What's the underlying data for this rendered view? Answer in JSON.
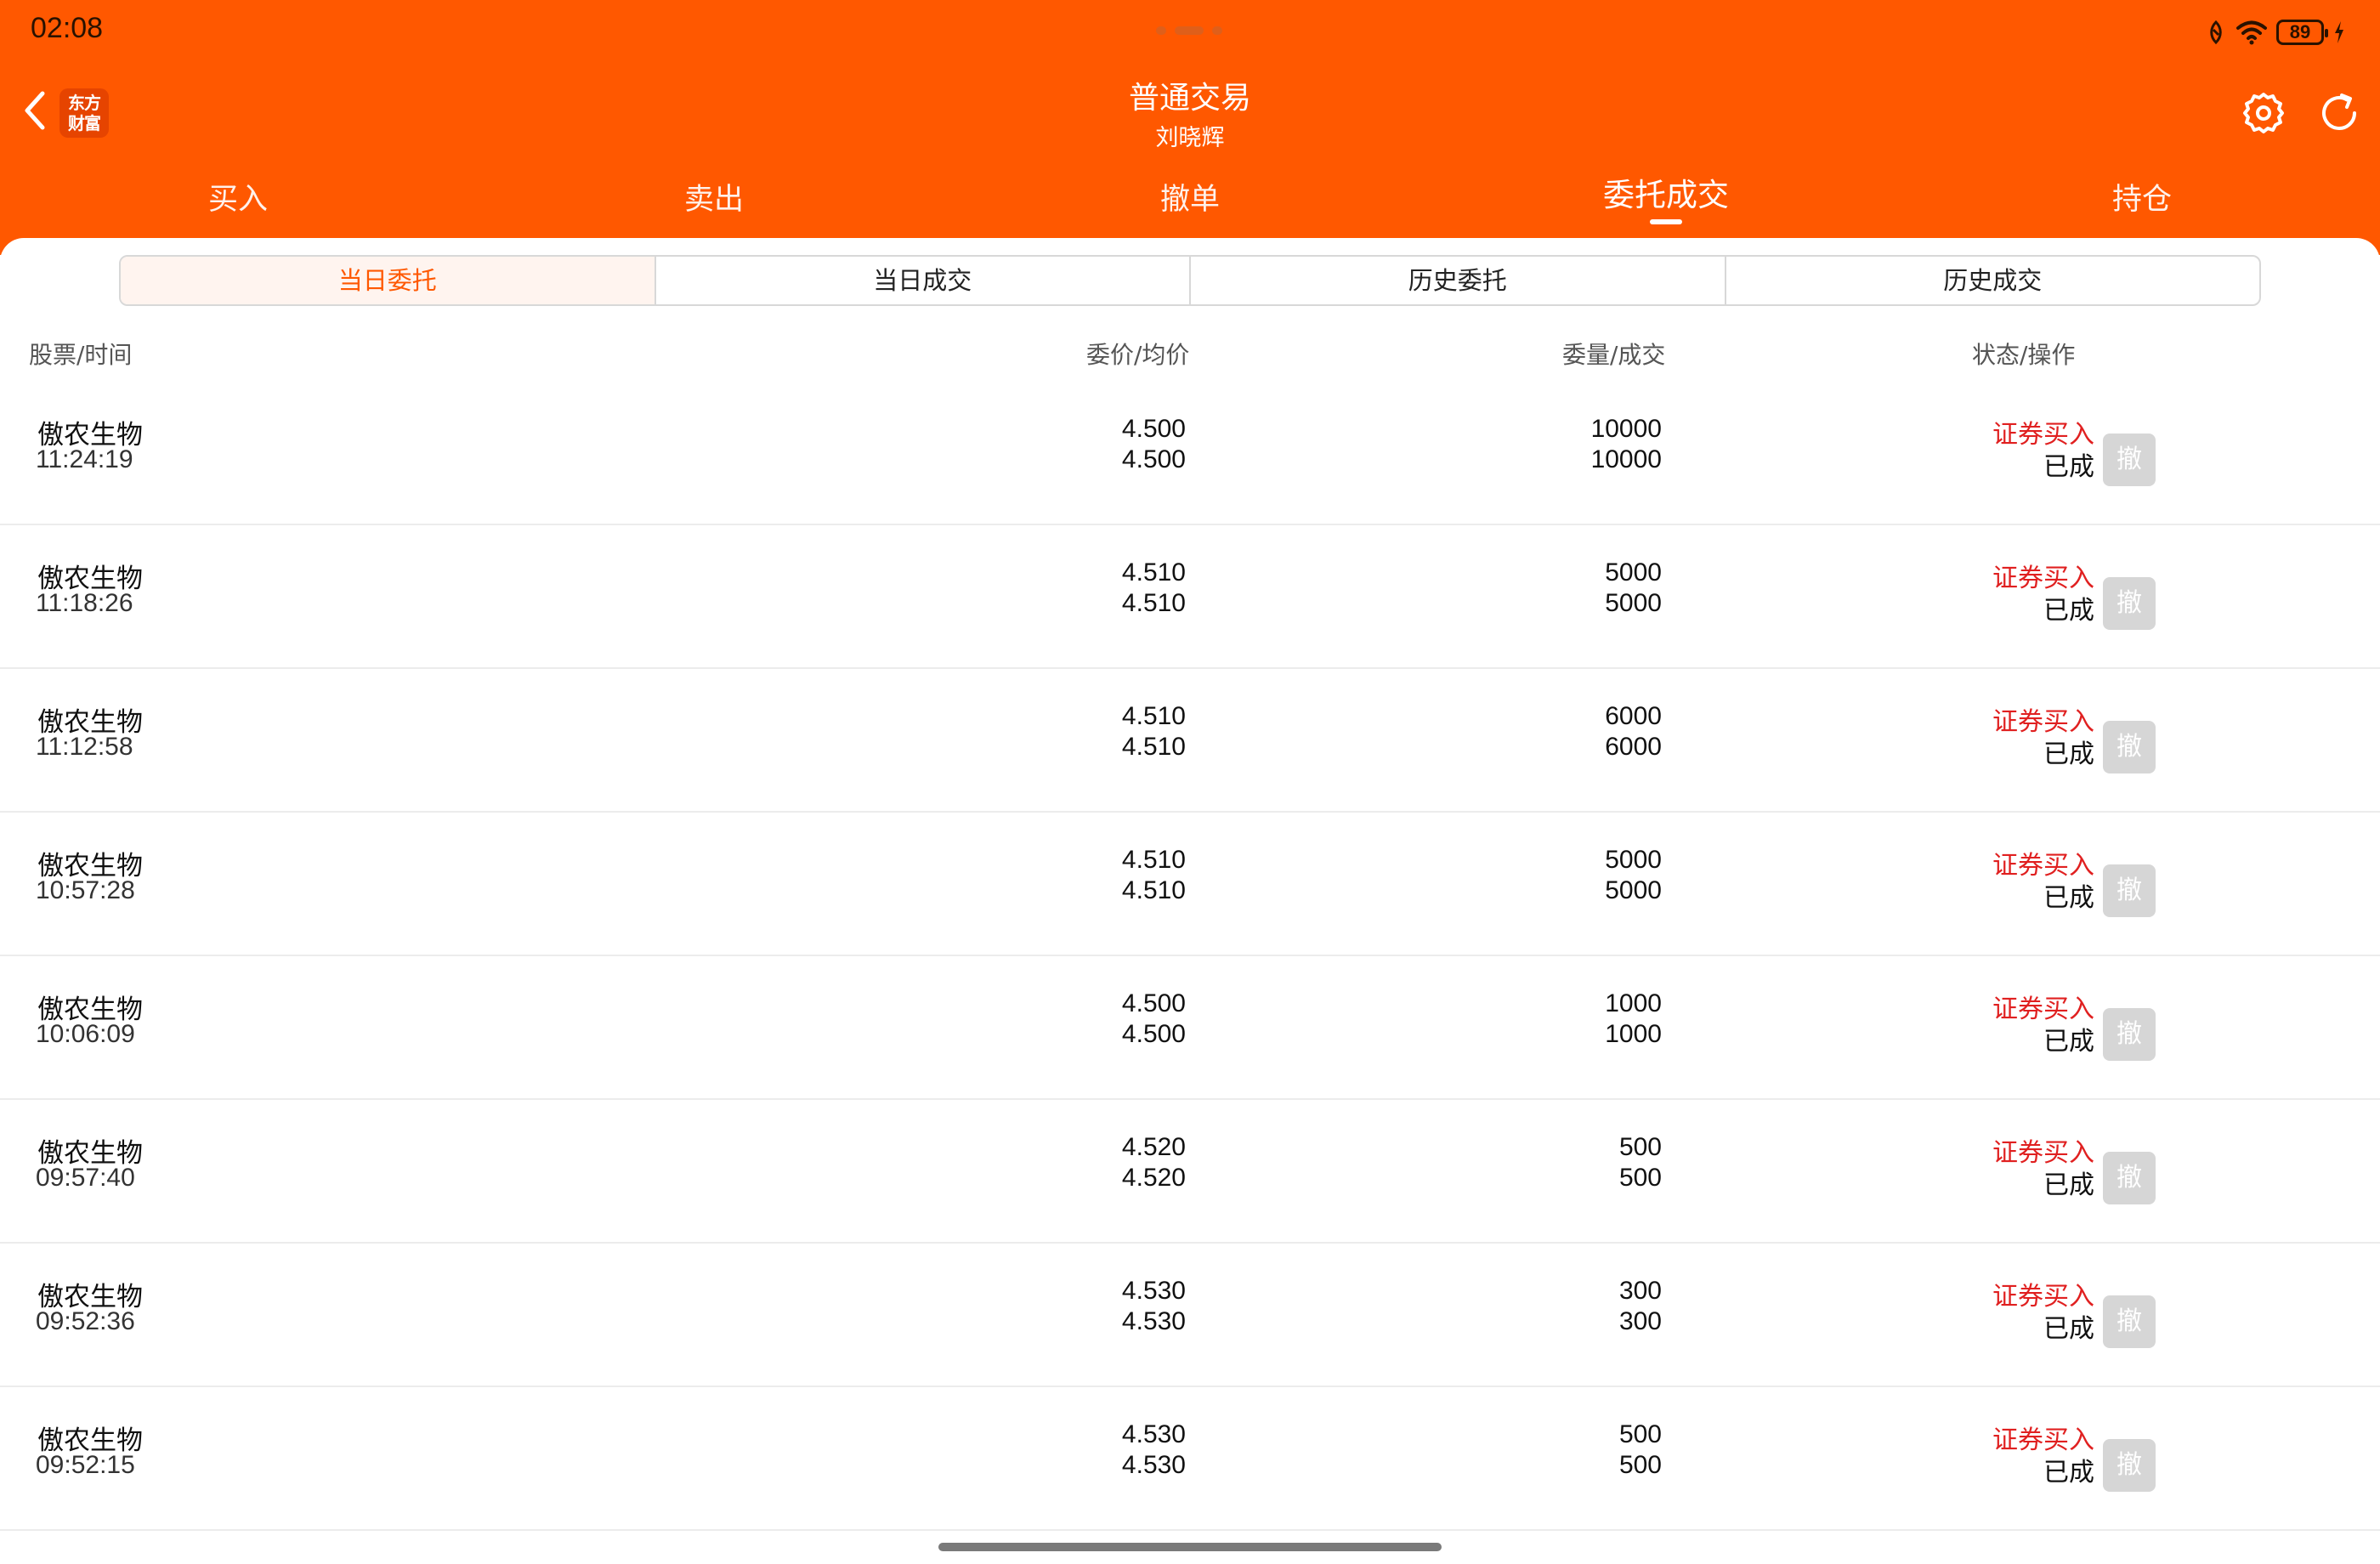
{
  "status_bar": {
    "time": "02:08",
    "battery": "89",
    "icons": [
      "nfc-icon",
      "wifi-icon",
      "battery-icon",
      "charging-icon"
    ]
  },
  "header": {
    "title": "普通交易",
    "subtitle": "刘晓辉",
    "logo_text": "东方财富",
    "accent_color": "#ff5800"
  },
  "tabs": [
    {
      "label": "买入"
    },
    {
      "label": "卖出"
    },
    {
      "label": "撤单"
    },
    {
      "label": "委托成交",
      "active": true
    },
    {
      "label": "持仓"
    }
  ],
  "segments": [
    {
      "label": "当日委托",
      "active": true
    },
    {
      "label": "当日成交"
    },
    {
      "label": "历史委托"
    },
    {
      "label": "历史成交"
    }
  ],
  "columns": {
    "stock_time": "股票/时间",
    "price": "委价/均价",
    "qty": "委量/成交",
    "status": "状态/操作"
  },
  "rows": [
    {
      "name": "傲农生物",
      "time": "11:24:19",
      "order_price": "4.500",
      "avg_price": "4.500",
      "order_qty": "10000",
      "filled_qty": "10000",
      "action": "证券买入",
      "state": "已成",
      "cancel": "撤"
    },
    {
      "name": "傲农生物",
      "time": "11:18:26",
      "order_price": "4.510",
      "avg_price": "4.510",
      "order_qty": "5000",
      "filled_qty": "5000",
      "action": "证券买入",
      "state": "已成",
      "cancel": "撤"
    },
    {
      "name": "傲农生物",
      "time": "11:12:58",
      "order_price": "4.510",
      "avg_price": "4.510",
      "order_qty": "6000",
      "filled_qty": "6000",
      "action": "证券买入",
      "state": "已成",
      "cancel": "撤"
    },
    {
      "name": "傲农生物",
      "time": "10:57:28",
      "order_price": "4.510",
      "avg_price": "4.510",
      "order_qty": "5000",
      "filled_qty": "5000",
      "action": "证券买入",
      "state": "已成",
      "cancel": "撤"
    },
    {
      "name": "傲农生物",
      "time": "10:06:09",
      "order_price": "4.500",
      "avg_price": "4.500",
      "order_qty": "1000",
      "filled_qty": "1000",
      "action": "证券买入",
      "state": "已成",
      "cancel": "撤"
    },
    {
      "name": "傲农生物",
      "time": "09:57:40",
      "order_price": "4.520",
      "avg_price": "4.520",
      "order_qty": "500",
      "filled_qty": "500",
      "action": "证券买入",
      "state": "已成",
      "cancel": "撤"
    },
    {
      "name": "傲农生物",
      "time": "09:52:36",
      "order_price": "4.530",
      "avg_price": "4.530",
      "order_qty": "300",
      "filled_qty": "300",
      "action": "证券买入",
      "state": "已成",
      "cancel": "撤"
    },
    {
      "name": "傲农生物",
      "time": "09:52:15",
      "order_price": "4.530",
      "avg_price": "4.530",
      "order_qty": "500",
      "filled_qty": "500",
      "action": "证券买入",
      "state": "已成",
      "cancel": "撤"
    }
  ]
}
